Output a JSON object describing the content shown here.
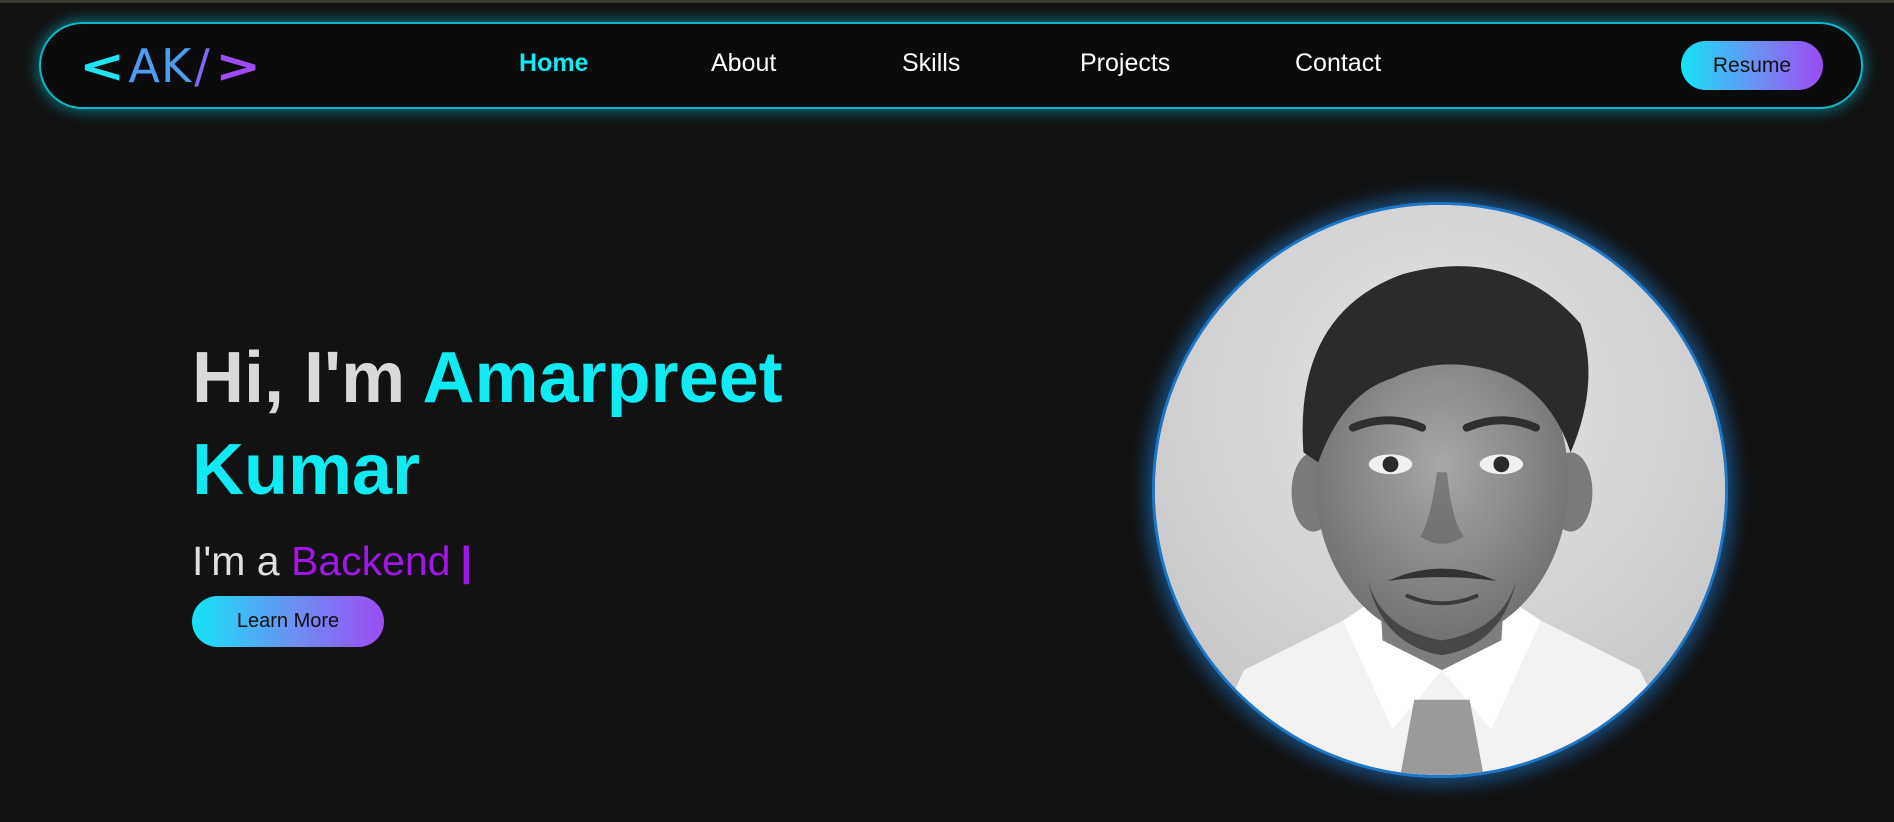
{
  "logo": {
    "left_bracket": "<",
    "initials": "AK",
    "slash": "/",
    "right_bracket": ">"
  },
  "nav": {
    "items": [
      {
        "label": "Home",
        "active": true
      },
      {
        "label": "About",
        "active": false
      },
      {
        "label": "Skills",
        "active": false
      },
      {
        "label": "Projects",
        "active": false
      },
      {
        "label": "Contact",
        "active": false
      }
    ],
    "resume_label": "Resume"
  },
  "hero": {
    "greeting": "Hi, I'm",
    "first_name": "Amarpreet",
    "last_name": "Kumar",
    "role_prefix": "I'm a",
    "role": "Backend",
    "cursor": "|",
    "cta_label": "Learn More"
  },
  "colors": {
    "background": "#121212",
    "accent_cyan": "#10eaf2",
    "accent_purple": "#a116e6",
    "gradient_start": "#15e3f6",
    "gradient_end": "#9b4cf3",
    "avatar_ring": "#1e77c6"
  }
}
